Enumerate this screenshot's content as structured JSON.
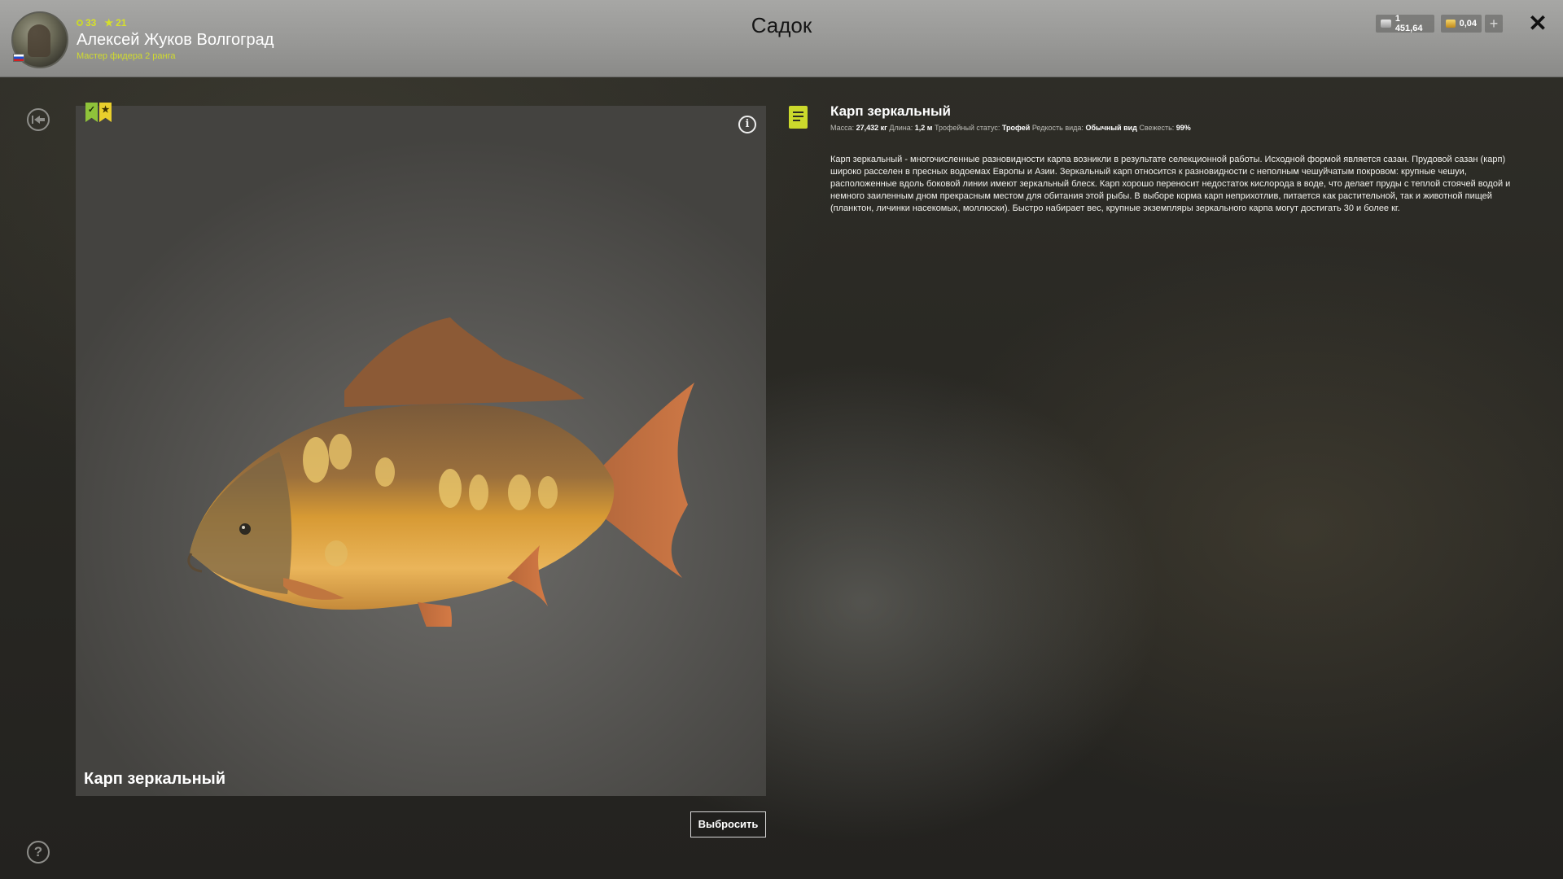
{
  "header": {
    "title": "Садок",
    "player": {
      "name": "Алексей Жуков Волгоград",
      "rank": "Мастер фидера 2 ранга",
      "level": "33",
      "stars": "21",
      "flag": "russia-flag"
    },
    "currency": {
      "silver": "1 451,64",
      "gold": "0,04",
      "add_label": "+"
    },
    "close_label": "✕"
  },
  "sidebar": {
    "back_icon": "back-circle-icon",
    "help_label": "?"
  },
  "viewer": {
    "badges": [
      "✓",
      "★"
    ],
    "info_label": "i",
    "caption": "Карп зеркальный",
    "discard_label": "Выбросить"
  },
  "details": {
    "title": "Карп зеркальный",
    "stats": {
      "mass_label": "Масса:",
      "mass_value": "27,432 кг",
      "length_label": "Длина:",
      "length_value": "1,2 м",
      "trophy_label": "Трофейный статус:",
      "trophy_value": "Трофей",
      "rarity_label": "Редкость вида:",
      "rarity_value": "Обычный вид",
      "freshness_label": "Свежесть:",
      "freshness_value": "99%"
    },
    "description": "Карп зеркальный - многочисленные разновидности карпа возникли в результате селекционной работы. Исходной формой является сазан. Прудовой сазан (карп) широко расселен в пресных водоемах Европы и Азии. Зеркальный карп относится к разновидности с неполным чешуйчатым покровом: крупные чешуи, расположенные вдоль боковой линии имеют зеркальный блеск. Карп хорошо переносит недостаток кислорода в воде, что делает пруды с теплой стоячей водой и немного заиленным дном прекрасным местом для обитания этой рыбы. В выборе корма карп неприхотлив, питается как растительной, так и животной пищей (планктон, личинки насекомых, моллюски). Быстро набирает вес, крупные экземпляры зеркального карпа могут достигать 30 и более кг."
  },
  "colors": {
    "accent": "#cbd92c",
    "badge_green": "#8fc33a",
    "badge_yellow": "#e9cf2c"
  }
}
